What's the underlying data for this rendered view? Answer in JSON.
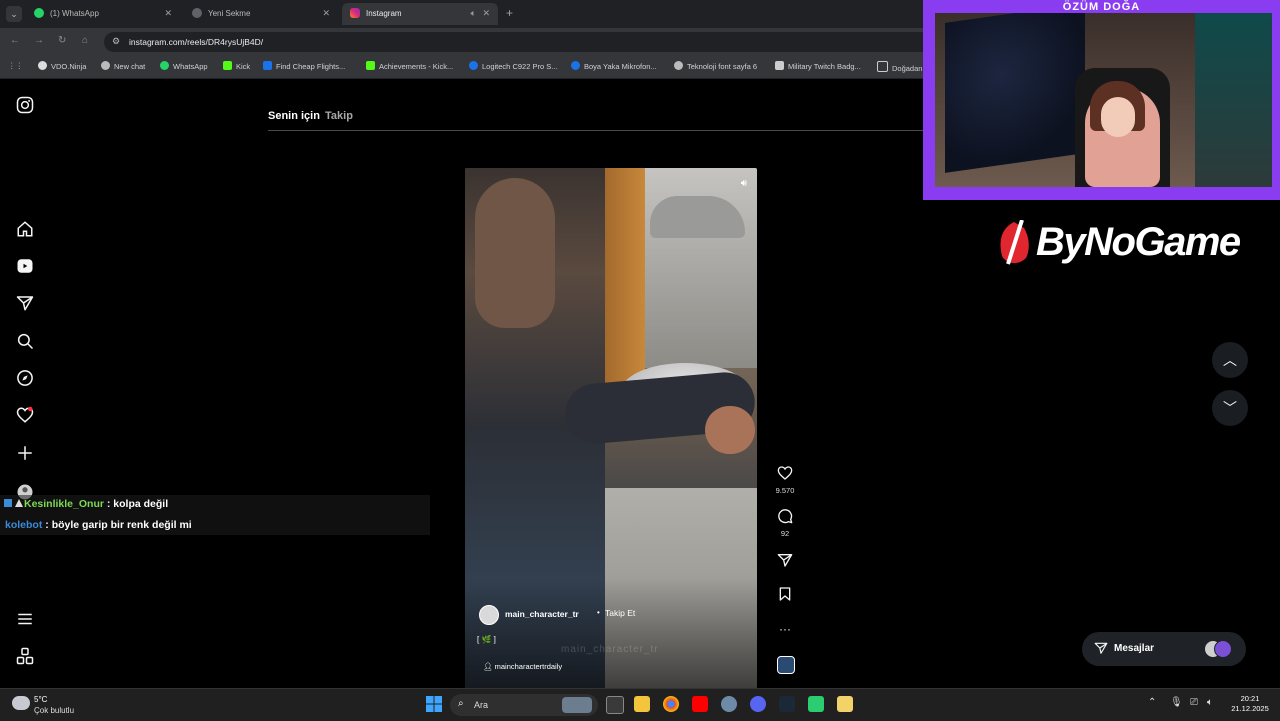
{
  "browser": {
    "tabs": [
      {
        "label": "(1) WhatsApp",
        "active": false
      },
      {
        "label": "Yeni Sekme",
        "active": false
      },
      {
        "label": "Instagram",
        "active": true
      }
    ],
    "url": "instagram.com/reels/DR4rysUjB4D/",
    "bookmarks": [
      "VDO.Ninja",
      "New chat",
      "WhatsApp",
      "Kick",
      "Find Cheap Flights...",
      "Achievements - Kick...",
      "Logitech C922 Pro S...",
      "Boya Yaka Mikrofon...",
      "Teknoloji font sayfa 6",
      "Military Twitch Badg...",
      "Doğadan"
    ]
  },
  "instagram": {
    "feed_tabs": [
      "Senin için",
      "Takip"
    ],
    "reel": {
      "author": "main_character_tr",
      "follow_label": "Takip Et",
      "caption": "[ 🌿 ]",
      "watermark": "main_character_tr",
      "audio": "maincharactertrdaily",
      "likes": "9.570",
      "comments": "92"
    },
    "messages_label": "Mesajlar"
  },
  "stream": {
    "cam_name": "ÖZÜM DOĞA",
    "sponsor": "ByNoGame",
    "chat": [
      {
        "user": "Kesinlikle_Onur",
        "sep": " : ",
        "text": "kolpa değil"
      },
      {
        "user": "kolebot",
        "sep": " : ",
        "text": "böyle garip bir renk değil mi"
      }
    ]
  },
  "taskbar": {
    "weather_temp": "5°C",
    "weather_cond": "Çok bulutlu",
    "search_placeholder": "Ara",
    "time": "20:21",
    "date": "21.12.2025"
  },
  "colors": {
    "accent_purple": "#8a3cf0",
    "chat_user1": "#7ed957",
    "chat_user2": "#3b8bd9",
    "background": "#000000"
  }
}
